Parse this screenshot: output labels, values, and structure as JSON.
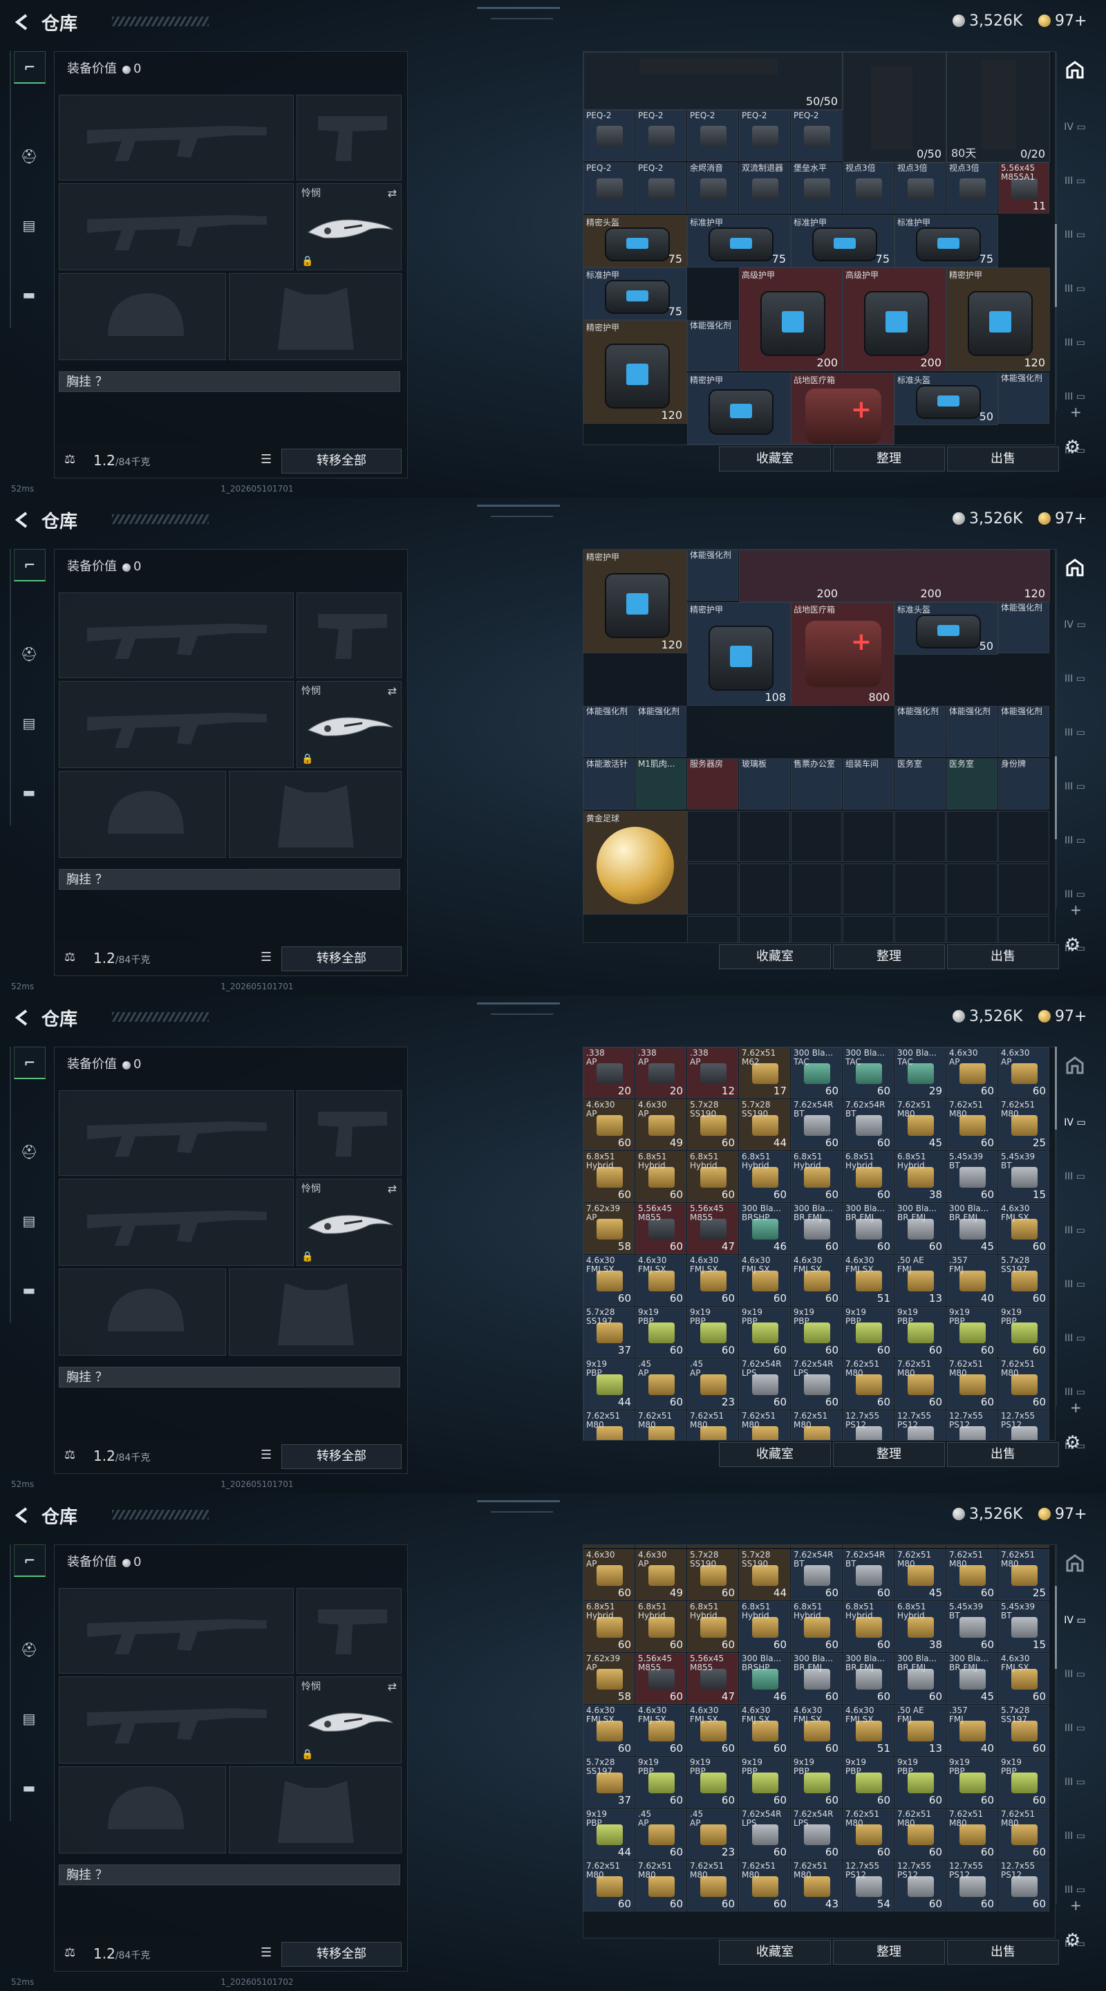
{
  "header": {
    "title": "仓库",
    "silver": "3,526K",
    "gold": "97+"
  },
  "equipment": {
    "value_label": "装备价值",
    "value": "0",
    "melee_label": "怜悯",
    "chest_label": "胸挂 ？",
    "weight": "1.2",
    "weight_max": "/84千克",
    "transfer_all": "转移全部"
  },
  "status": {
    "ping": "52ms",
    "versions": [
      "1_202605101701",
      "1_202605101701",
      "1_202605101701",
      "1_202605101702"
    ]
  },
  "actions": {
    "collection": "收藏室",
    "sort": "整理",
    "sell": "出售"
  },
  "sidebar_roman": [
    "IV",
    "III",
    "III",
    "III",
    "III",
    "III",
    "III",
    "III",
    "III"
  ],
  "panel1": {
    "top_row": [
      "",
      "",
      "",
      "",
      "50/50",
      "",
      "",
      "",
      ""
    ],
    "gun_left": "0/50",
    "timer": "80天",
    "gun_right": "0/20",
    "row_a": [
      {
        "n": "PEQ-2",
        "q": ""
      },
      {
        "n": "PEQ-2",
        "q": ""
      },
      {
        "n": "PEQ-2",
        "q": ""
      },
      {
        "n": "PEQ-2",
        "q": ""
      },
      {
        "n": "PEQ-2",
        "q": ""
      }
    ],
    "row_b": [
      {
        "n": "PEQ-2",
        "q": ""
      },
      {
        "n": "PEQ-2",
        "q": ""
      },
      {
        "n": "余烬消音",
        "q": ""
      },
      {
        "n": "双流制退器",
        "q": ""
      },
      {
        "n": "堡垒水平",
        "q": ""
      },
      {
        "n": "视点3倍",
        "q": ""
      },
      {
        "n": "视点3倍",
        "q": ""
      },
      {
        "n": "视点3倍",
        "q": ""
      },
      {
        "n": "5.56x45\nM855A1",
        "q": "11"
      }
    ],
    "armors": [
      {
        "n": "精密头盔",
        "q": "75",
        "c": "brown"
      },
      {
        "n": "标准护甲",
        "q": "75",
        "c": "blue"
      },
      {
        "n": "标准护甲",
        "q": "75",
        "c": "blue"
      },
      {
        "n": "标准护甲",
        "q": "75",
        "c": "blue"
      },
      {
        "n": "高级护甲",
        "q": "200",
        "c": "red"
      },
      {
        "n": "高级护甲",
        "q": "200",
        "c": "red"
      },
      {
        "n": "精密护甲",
        "q": "120",
        "c": "brown"
      },
      {
        "n": "精密护甲",
        "q": "120",
        "c": "brown"
      },
      {
        "n": "精密护甲",
        "q": "",
        "c": "blue"
      },
      {
        "n": "战地医疗箱",
        "q": "",
        "c": "red"
      },
      {
        "n": "标准头盔",
        "q": "50",
        "c": "blue"
      }
    ],
    "injectors": [
      "体能强化剂",
      "体能强化剂",
      "体能强化剂",
      "体能强化剂",
      "体能强化剂",
      "体能强化剂"
    ]
  },
  "panel2": {
    "armors": [
      {
        "n": "精密护甲",
        "q": "120"
      },
      {
        "n": "精密护甲",
        "q": "108"
      },
      {
        "n": "战地医疗箱",
        "q": "800"
      },
      {
        "n": "标准头盔",
        "q": "50"
      }
    ],
    "row_c": [
      {
        "n": "体能强化剂",
        "c": "blue"
      },
      {
        "n": "体能强化剂",
        "c": "blue"
      },
      {
        "n": "体能强化剂",
        "c": "blue"
      },
      {
        "n": "体能强化剂",
        "c": "blue"
      },
      {
        "n": "体能强化剂",
        "c": "blue"
      }
    ],
    "row_d": [
      {
        "n": "体能激活针",
        "c": "blue"
      },
      {
        "n": "M1肌肉...",
        "c": "teal"
      },
      {
        "n": "服务器房",
        "c": "red"
      },
      {
        "n": "玻璃板",
        "c": "blue"
      },
      {
        "n": "售票办公室",
        "c": "blue"
      },
      {
        "n": "组装车间",
        "c": "blue"
      },
      {
        "n": "医务室",
        "c": "blue"
      },
      {
        "n": "医务室",
        "c": "teal"
      },
      {
        "n": "身份牌",
        "c": "blue"
      }
    ],
    "ball": "黄金足球",
    "top_qty": [
      "200",
      "200",
      "120"
    ]
  },
  "ammo_rows": [
    [
      {
        "n": ".338\nAP",
        "q": "20",
        "c": "red",
        "b": "k"
      },
      {
        "n": ".338\nAP",
        "q": "20",
        "c": "red",
        "b": "k"
      },
      {
        "n": ".338\nAP",
        "q": "12",
        "c": "red",
        "b": "k"
      },
      {
        "n": "7.62x51\nM62",
        "q": "17",
        "c": "brown",
        "b": "y"
      },
      {
        "n": "300 Bla...\nTAC",
        "q": "60",
        "c": "blue",
        "b": "t"
      },
      {
        "n": "300 Bla...\nTAC",
        "q": "60",
        "c": "blue",
        "b": "t"
      },
      {
        "n": "300 Bla...\nTAC",
        "q": "29",
        "c": "blue",
        "b": "t"
      },
      {
        "n": "4.6x30\nAP",
        "q": "60",
        "c": "blue",
        "b": "y"
      },
      {
        "n": "4.6x30\nAP",
        "q": "60",
        "c": "blue",
        "b": "y"
      }
    ],
    [
      {
        "n": "4.6x30\nAP",
        "q": "60",
        "c": "brown",
        "b": "y"
      },
      {
        "n": "4.6x30\nAP",
        "q": "49",
        "c": "brown",
        "b": "y"
      },
      {
        "n": "5.7x28\nSS190",
        "q": "60",
        "c": "brown",
        "b": "y"
      },
      {
        "n": "5.7x28\nSS190",
        "q": "44",
        "c": "brown",
        "b": "y"
      },
      {
        "n": "7.62x54R\nBT",
        "q": "60",
        "c": "blue",
        "b": "g"
      },
      {
        "n": "7.62x54R\nBT",
        "q": "60",
        "c": "blue",
        "b": "g"
      },
      {
        "n": "7.62x51\nM80",
        "q": "45",
        "c": "blue",
        "b": "y"
      },
      {
        "n": "7.62x51\nM80",
        "q": "60",
        "c": "blue",
        "b": "y"
      },
      {
        "n": "7.62x51\nM80",
        "q": "25",
        "c": "blue",
        "b": "y"
      }
    ],
    [
      {
        "n": "6.8x51\nHybrid",
        "q": "60",
        "c": "brown",
        "b": "y"
      },
      {
        "n": "6.8x51\nHybrid",
        "q": "60",
        "c": "brown",
        "b": "y"
      },
      {
        "n": "6.8x51\nHybrid",
        "q": "60",
        "c": "brown",
        "b": "y"
      },
      {
        "n": "6.8x51\nHybrid",
        "q": "60",
        "c": "blue",
        "b": "y"
      },
      {
        "n": "6.8x51\nHybrid",
        "q": "60",
        "c": "blue",
        "b": "y"
      },
      {
        "n": "6.8x51\nHybrid",
        "q": "60",
        "c": "blue",
        "b": "y"
      },
      {
        "n": "6.8x51\nHybrid",
        "q": "38",
        "c": "blue",
        "b": "y"
      },
      {
        "n": "5.45x39\nBT",
        "q": "60",
        "c": "blue",
        "b": "g"
      },
      {
        "n": "5.45x39\nBT",
        "q": "15",
        "c": "blue",
        "b": "g"
      }
    ],
    [
      {
        "n": "7.62x39\nAP",
        "q": "58",
        "c": "brown",
        "b": "y"
      },
      {
        "n": "5.56x45\nM855",
        "q": "60",
        "c": "red",
        "b": "k"
      },
      {
        "n": "5.56x45\nM855",
        "q": "47",
        "c": "red",
        "b": "k"
      },
      {
        "n": "300 Bla...\nBRSHP",
        "q": "46",
        "c": "blue",
        "b": "t"
      },
      {
        "n": "300 Bla...\nBR FMJ",
        "q": "60",
        "c": "blue",
        "b": "g"
      },
      {
        "n": "300 Bla...\nBR FMJ",
        "q": "60",
        "c": "blue",
        "b": "g"
      },
      {
        "n": "300 Bla...\nBR FMJ",
        "q": "60",
        "c": "blue",
        "b": "g"
      },
      {
        "n": "300 Bla...\nBR FMJ",
        "q": "45",
        "c": "blue",
        "b": "g"
      },
      {
        "n": "4.6x30\nFMJ SX",
        "q": "60",
        "c": "blue",
        "b": "y"
      }
    ],
    [
      {
        "n": "4.6x30\nFMJ SX",
        "q": "60",
        "c": "blue",
        "b": "y"
      },
      {
        "n": "4.6x30\nFMJ SX",
        "q": "60",
        "c": "blue",
        "b": "y"
      },
      {
        "n": "4.6x30\nFMJ SX",
        "q": "60",
        "c": "blue",
        "b": "y"
      },
      {
        "n": "4.6x30\nFMJ SX",
        "q": "60",
        "c": "blue",
        "b": "y"
      },
      {
        "n": "4.6x30\nFMJ SX",
        "q": "60",
        "c": "blue",
        "b": "y"
      },
      {
        "n": "4.6x30\nFMJ SX",
        "q": "51",
        "c": "blue",
        "b": "y"
      },
      {
        "n": ".50 AE\nFMJ",
        "q": "13",
        "c": "blue",
        "b": "y"
      },
      {
        "n": ".357\nFMJ",
        "q": "40",
        "c": "blue",
        "b": "y"
      },
      {
        "n": "5.7x28\nSS197",
        "q": "60",
        "c": "blue",
        "b": "y"
      }
    ],
    [
      {
        "n": "5.7x28\nSS197",
        "q": "37",
        "c": "blue",
        "b": "y"
      },
      {
        "n": "9x19\nPBP",
        "q": "60",
        "c": "blue",
        "b": "l"
      },
      {
        "n": "9x19\nPBP",
        "q": "60",
        "c": "blue",
        "b": "l"
      },
      {
        "n": "9x19\nPBP",
        "q": "60",
        "c": "blue",
        "b": "l"
      },
      {
        "n": "9x19\nPBP",
        "q": "60",
        "c": "blue",
        "b": "l"
      },
      {
        "n": "9x19\nPBP",
        "q": "60",
        "c": "blue",
        "b": "l"
      },
      {
        "n": "9x19\nPBP",
        "q": "60",
        "c": "blue",
        "b": "l"
      },
      {
        "n": "9x19\nPBP",
        "q": "60",
        "c": "blue",
        "b": "l"
      },
      {
        "n": "9x19\nPBP",
        "q": "60",
        "c": "blue",
        "b": "l"
      }
    ],
    [
      {
        "n": "9x19\nPBP",
        "q": "44",
        "c": "blue",
        "b": "l"
      },
      {
        "n": ".45\nAP",
        "q": "60",
        "c": "blue",
        "b": "y"
      },
      {
        "n": ".45\nAP",
        "q": "23",
        "c": "blue",
        "b": "y"
      },
      {
        "n": "7.62x54R\nLPS",
        "q": "60",
        "c": "blue",
        "b": "g"
      },
      {
        "n": "7.62x54R\nLPS",
        "q": "60",
        "c": "blue",
        "b": "g"
      },
      {
        "n": "7.62x51\nM80",
        "q": "60",
        "c": "blue",
        "b": "y"
      },
      {
        "n": "7.62x51\nM80",
        "q": "60",
        "c": "blue",
        "b": "y"
      },
      {
        "n": "7.62x51\nM80",
        "q": "60",
        "c": "blue",
        "b": "y"
      },
      {
        "n": "7.62x51\nM80",
        "q": "60",
        "c": "blue",
        "b": "y"
      }
    ],
    [
      {
        "n": "7.62x51\nM80",
        "q": "60",
        "c": "blue",
        "b": "y"
      },
      {
        "n": "7.62x51\nM80",
        "q": "60",
        "c": "blue",
        "b": "y"
      },
      {
        "n": "7.62x51\nM80",
        "q": "60",
        "c": "blue",
        "b": "y"
      },
      {
        "n": "7.62x51\nM80",
        "q": "60",
        "c": "blue",
        "b": "y"
      },
      {
        "n": "7.62x51\nM80",
        "q": "43",
        "c": "blue",
        "b": "y"
      },
      {
        "n": "12.7x55\nPS12",
        "q": "54",
        "c": "blue",
        "b": "g"
      },
      {
        "n": "12.7x55\nPS12",
        "q": "60",
        "c": "blue",
        "b": "g"
      },
      {
        "n": "12.7x55\nPS12",
        "q": "60",
        "c": "blue",
        "b": "g"
      },
      {
        "n": "12.7x55\nPS12",
        "q": "60",
        "c": "blue",
        "b": "g"
      }
    ]
  ],
  "panel4_first_qty": [
    "",
    "49",
    "60",
    "44",
    "60",
    "60",
    "45",
    "60",
    "25"
  ]
}
